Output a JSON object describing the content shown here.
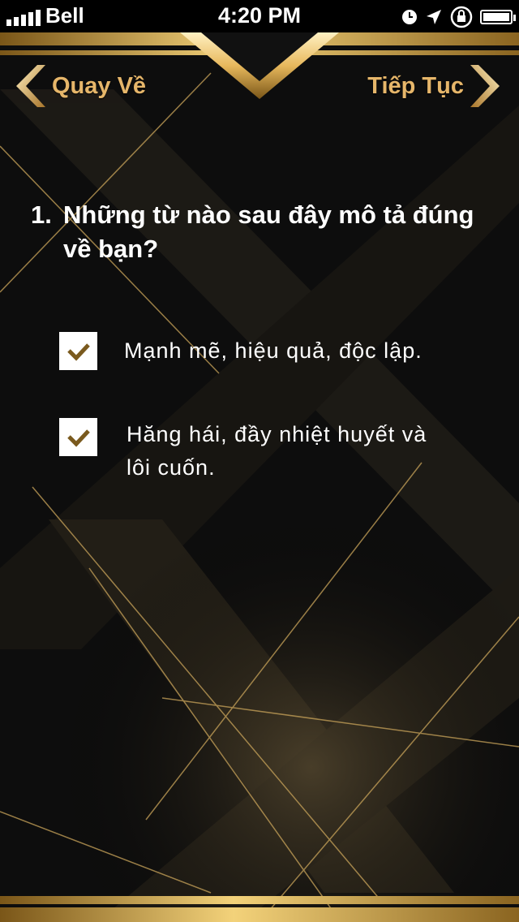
{
  "status_bar": {
    "carrier": "Bell",
    "time": "4:20 PM"
  },
  "nav": {
    "back_label": "Quay Về",
    "next_label": "Tiếp Tục"
  },
  "question": {
    "number": "1.",
    "text": "Những từ nào sau đây mô tả đúng về bạn?"
  },
  "options": [
    {
      "label": "Mạnh mẽ, hiệu quả, độc lập.",
      "checked": true
    },
    {
      "label": "Hăng hái, đầy nhiệt huyết và lôi cuốn.",
      "checked": true
    }
  ],
  "colors": {
    "gold": "#e6b66a",
    "background": "#0d0d0d",
    "check": "#7a5a1e"
  }
}
